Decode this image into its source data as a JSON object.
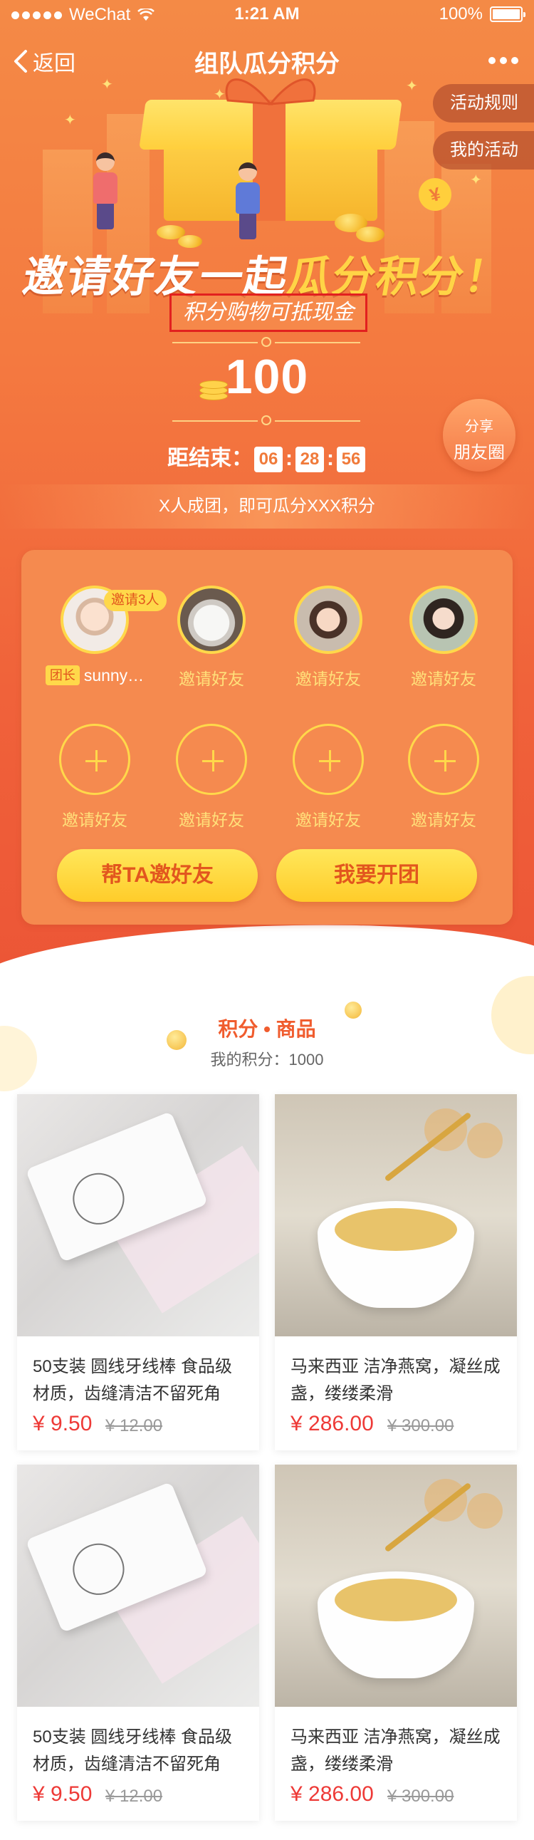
{
  "status_bar": {
    "carrier": "WeChat",
    "time": "1:21 AM",
    "battery": "100%"
  },
  "nav": {
    "back_label": "返回",
    "title": "组队瓜分积分"
  },
  "side_buttons": {
    "rules": "活动规则",
    "my_activity": "我的活动"
  },
  "hero": {
    "headline_white": "邀请好友一起",
    "headline_yellow": "瓜分积分！",
    "subtitle": "积分购物可抵现金",
    "points": "100",
    "countdown_label": "距结束：",
    "countdown_h": "06",
    "countdown_m": "28",
    "countdown_s": "56",
    "share_line1": "分享",
    "share_line2": "朋友圈",
    "rule_text": "X人成团，即可瓜分XXX积分"
  },
  "team": {
    "leader_badge": "邀请3人",
    "leader_tag": "团长",
    "leader_name": "sunny…",
    "member_label": "邀请好友",
    "slots_row2": [
      "邀请好友",
      "邀请好友",
      "邀请好友",
      "邀请好友"
    ],
    "btn_invite": "帮TA邀好友",
    "btn_open": "我要开团"
  },
  "products_section": {
    "title": "积分 • 商品",
    "my_points": "我的积分：1000"
  },
  "products": [
    {
      "title": "50支装 圆线牙线棒 食品级材质，齿缝清洁不留死角",
      "price": "¥ 9.50",
      "old_price": "¥ 12.00"
    },
    {
      "title": "马来西亚 洁净燕窝，凝丝成盏，缕缕柔滑",
      "price": "¥ 286.00",
      "old_price": "¥ 300.00"
    },
    {
      "title": "50支装 圆线牙线棒 食品级材质，齿缝清洁不留死角",
      "price": "¥ 9.50",
      "old_price": "¥ 12.00"
    },
    {
      "title": "马来西亚 洁净燕窝，凝丝成盏，缕缕柔滑",
      "price": "¥ 286.00",
      "old_price": "¥ 300.00"
    }
  ],
  "colors": {
    "hero_orange": "#f47a40",
    "accent_yellow": "#ffd84a",
    "price_red": "#ee3a37",
    "highlight_red": "#e2201f"
  }
}
